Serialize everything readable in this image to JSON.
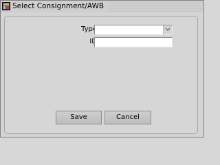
{
  "window": {
    "title": "Select Consignment/AWB",
    "icon": "oracle-forms-icon"
  },
  "form": {
    "type_label": "Type",
    "type_value": "",
    "id_label": "ID",
    "id_value": "",
    "dropdown_icon": "chevron-down-icon"
  },
  "buttons": {
    "save_label": "Save",
    "cancel_label": "Cancel"
  }
}
